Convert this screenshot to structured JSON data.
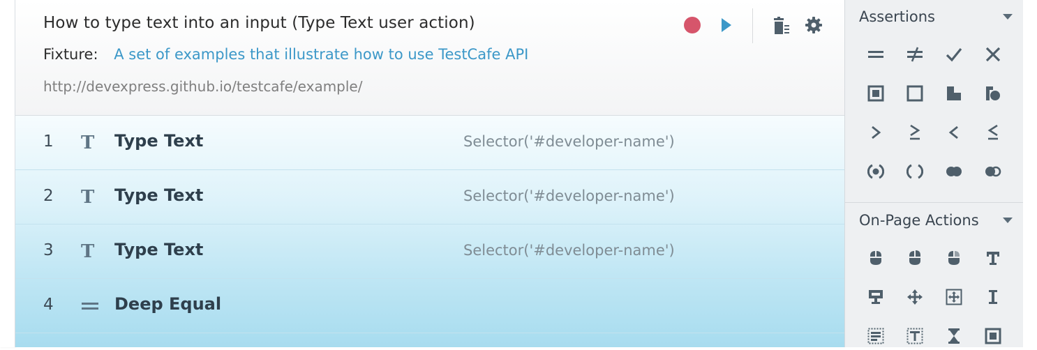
{
  "test": {
    "title": "How to type text into an input (Type Text user action)",
    "fixture_label": "Fixture:",
    "fixture_name": "A set of examples that illustrate how to use TestCafe API",
    "url": "http://devexpress.github.io/testcafe/example/"
  },
  "header_icons": [
    "record-icon",
    "run-icon",
    "delete-icon",
    "settings-icon"
  ],
  "steps": [
    {
      "num": "1",
      "icon": "type-text-icon",
      "name": "Type Text",
      "selector": "Selector('#developer-name')"
    },
    {
      "num": "2",
      "icon": "type-text-icon",
      "name": "Type Text",
      "selector": "Selector('#developer-name')"
    },
    {
      "num": "3",
      "icon": "type-text-icon",
      "name": "Type Text",
      "selector": "Selector('#developer-name')"
    },
    {
      "num": "4",
      "icon": "deep-equal-icon",
      "name": "Deep Equal",
      "selector": ""
    }
  ],
  "sidebar": {
    "assertions": {
      "title": "Assertions",
      "tools": [
        "deep-equal-icon",
        "not-deep-equal-icon",
        "ok-icon",
        "not-ok-icon",
        "contains-icon",
        "not-contains-icon",
        "type-of-icon",
        "not-type-of-icon",
        "greater-than-icon",
        "greater-or-equal-icon",
        "less-than-icon",
        "less-or-equal-icon",
        "within-icon",
        "not-within-icon",
        "match-icon",
        "not-match-icon"
      ]
    },
    "actions": {
      "title": "On-Page Actions",
      "tools": [
        "click-icon",
        "right-click-icon",
        "double-click-icon",
        "type-text-icon",
        "hover-icon",
        "drag-icon",
        "drag-to-element-icon",
        "select-text-icon",
        "select-textarea-content-icon",
        "select-editable-content-icon",
        "wait-icon",
        "press-key-icon"
      ]
    }
  },
  "colors": {
    "record": "#d6556b",
    "run": "#3c98c8",
    "link": "#3c98c8",
    "icon": "#5f7585"
  }
}
